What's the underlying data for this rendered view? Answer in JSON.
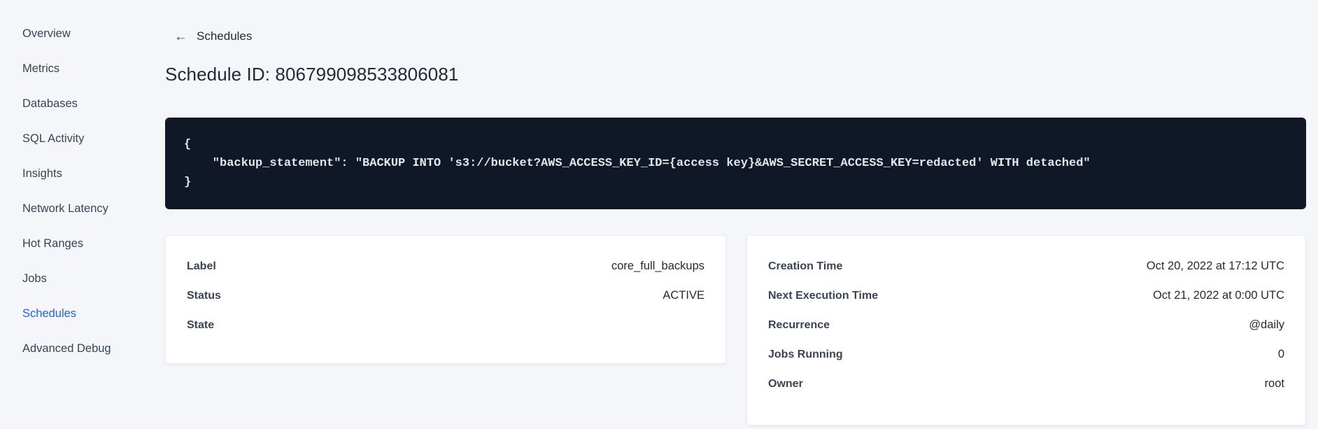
{
  "sidebar": {
    "items": [
      {
        "label": "Overview"
      },
      {
        "label": "Metrics"
      },
      {
        "label": "Databases"
      },
      {
        "label": "SQL Activity"
      },
      {
        "label": "Insights"
      },
      {
        "label": "Network Latency"
      },
      {
        "label": "Hot Ranges"
      },
      {
        "label": "Jobs"
      },
      {
        "label": "Schedules",
        "active": true
      },
      {
        "label": "Advanced Debug"
      }
    ]
  },
  "header": {
    "back_label": "Schedules",
    "back_arrow": "←",
    "title": "Schedule ID: 806799098533806081"
  },
  "code_block": {
    "text": "{\n    \"backup_statement\": \"BACKUP INTO 's3://bucket?AWS_ACCESS_KEY_ID={access key}&AWS_SECRET_ACCESS_KEY=redacted' WITH detached\"\n}"
  },
  "left_card": {
    "rows": [
      {
        "label": "Label",
        "value": "core_full_backups"
      },
      {
        "label": "Status",
        "value": "ACTIVE"
      },
      {
        "label": "State",
        "value": ""
      }
    ]
  },
  "right_card": {
    "rows": [
      {
        "label": "Creation Time",
        "value": "Oct 20, 2022 at 17:12 UTC"
      },
      {
        "label": "Next Execution Time",
        "value": "Oct 21, 2022 at 0:00 UTC"
      },
      {
        "label": "Recurrence",
        "value": "@daily"
      },
      {
        "label": "Jobs Running",
        "value": "0"
      },
      {
        "label": "Owner",
        "value": "root"
      }
    ]
  },
  "colors": {
    "accent": "#2161f0",
    "code_background": "#101727",
    "code_text": "#e2e6ed",
    "page_background": "#f4f6fa"
  }
}
